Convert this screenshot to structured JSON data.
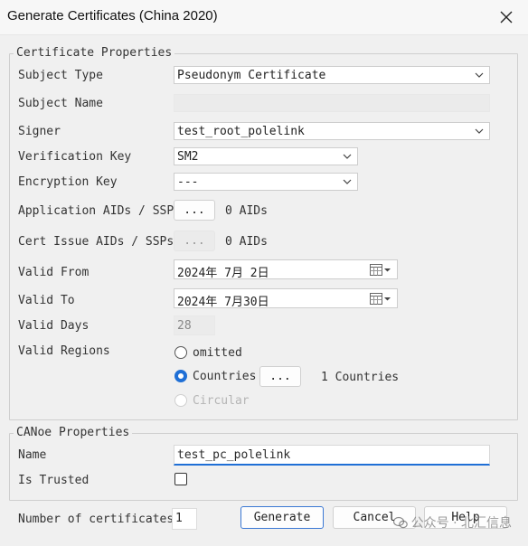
{
  "window": {
    "title": "Generate Certificates (China 2020)",
    "close_icon": "close-icon"
  },
  "cert_properties": {
    "group_title": "Certificate Properties",
    "subject_type": {
      "label": "Subject Type",
      "value": "Pseudonym Certificate"
    },
    "subject_name": {
      "label": "Subject Name",
      "value": ""
    },
    "signer": {
      "label": "Signer",
      "value": "test_root_polelink"
    },
    "verification_key": {
      "label": "Verification Key",
      "value": "SM2"
    },
    "encryption_key": {
      "label": "Encryption Key",
      "value": "---"
    },
    "application_aids": {
      "label": "Application AIDs / SSPs",
      "button": "...",
      "count": "0 AIDs"
    },
    "cert_issue_aids": {
      "label": "Cert Issue AIDs / SSPs",
      "button": "...",
      "count": "0 AIDs"
    },
    "valid_from": {
      "label": "Valid From",
      "value": "2024年 7月 2日"
    },
    "valid_to": {
      "label": "Valid To",
      "value": "2024年 7月30日"
    },
    "valid_days": {
      "label": "Valid Days",
      "value": "28"
    },
    "valid_regions": {
      "label": "Valid Regions",
      "options": {
        "omitted": "omitted",
        "countries": "Countries",
        "circular": "Circular"
      },
      "countries_button": "...",
      "countries_count": "1 Countries",
      "selected": "Countries"
    }
  },
  "canoe_properties": {
    "group_title": "CANoe Properties",
    "name": {
      "label": "Name",
      "value": "test_pc_polelink"
    },
    "is_trusted": {
      "label": "Is Trusted",
      "checked": false
    }
  },
  "footer": {
    "num_certs_label": "Number of certificates",
    "num_certs_value": "1",
    "generate": "Generate",
    "cancel": "Cancel",
    "help": "Help",
    "watermark": "公众号 · 北汇信息"
  },
  "colors": {
    "accent": "#1f6fd6",
    "focus_underline": "#1f6fd6"
  }
}
